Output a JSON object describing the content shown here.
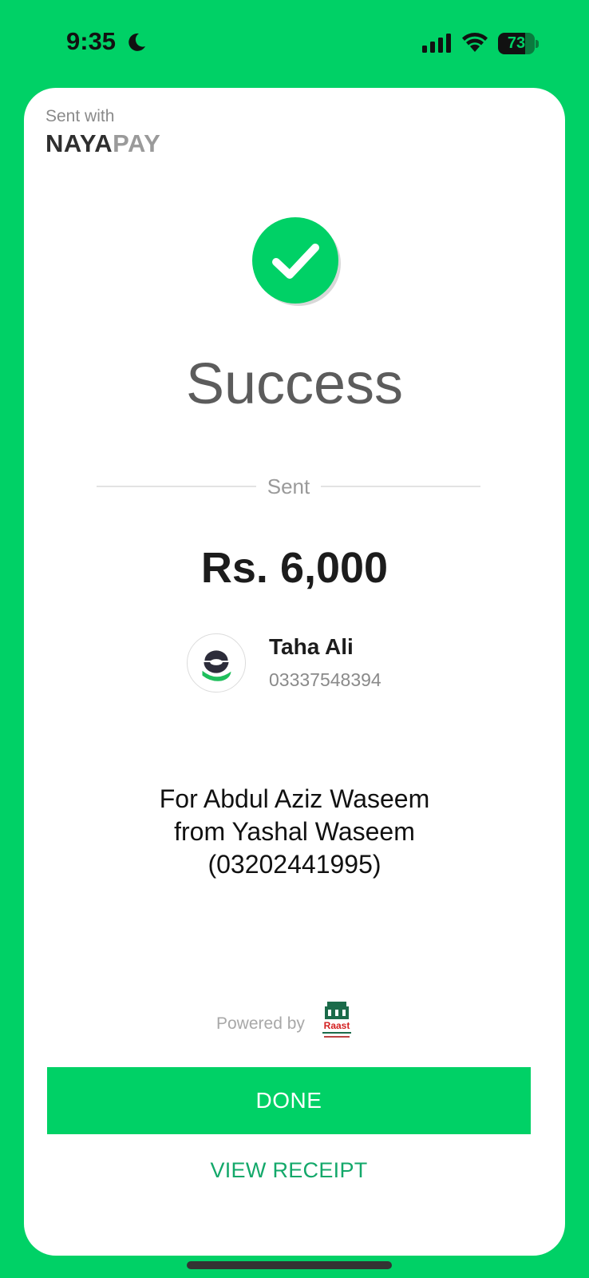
{
  "status_bar": {
    "time": "9:35",
    "battery": "73",
    "battery_level": 0.73,
    "icons": [
      "moon-icon",
      "signal-icon",
      "wifi-icon",
      "battery-icon"
    ]
  },
  "header": {
    "sent_with": "Sent with",
    "brand_dark": "NAYA",
    "brand_light": "PAY"
  },
  "result": {
    "icon": "checkmark-circle-icon",
    "title": "Success",
    "divider_label": "Sent",
    "amount": "Rs. 6,000"
  },
  "recipient": {
    "name": "Taha Ali",
    "phone": "03337548394",
    "avatar": "easypaisa-logo"
  },
  "note": {
    "line1": "For Abdul Aziz Waseem",
    "line2": "from Yashal Waseem",
    "line3": "(03202441995)"
  },
  "footer": {
    "powered_by": "Powered by",
    "partner_logo_text": "Raast",
    "done_label": "DONE",
    "receipt_label": "VIEW RECEIPT"
  },
  "colors": {
    "background": "#00d166",
    "accent": "#13a86a",
    "card": "#ffffff"
  }
}
